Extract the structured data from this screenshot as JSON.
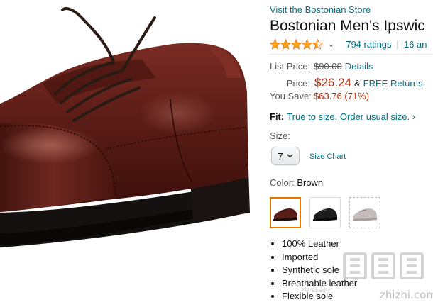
{
  "product": {
    "store_link": "Visit the Bostonian Store",
    "title": "Bostonian Men's Ipswic",
    "rating": {
      "stars": 4.5,
      "ratings_link": "794 ratings",
      "separator": "|",
      "answers_link": "16 an"
    }
  },
  "pricing": {
    "list_price_label": "List Price:",
    "list_price": "$90.00",
    "details_link": "Details",
    "price_label": "Price:",
    "price": "$26.24",
    "ampersand": "&",
    "returns_link": "FREE Returns",
    "save_label": "You Save:",
    "save_value": "$63.76 (71%)"
  },
  "fit": {
    "label": "Fit:",
    "link": "True to size. Order usual size. ›"
  },
  "size": {
    "label": "Size:",
    "selected": "7",
    "chart_link": "Size Chart"
  },
  "color": {
    "label": "Color:",
    "selected": "Brown",
    "swatches": [
      {
        "name": "brown",
        "selected": true
      },
      {
        "name": "black",
        "selected": false
      },
      {
        "name": "grey",
        "selected": false,
        "unavailable": true
      }
    ]
  },
  "features": [
    "100% Leather",
    "Imported",
    "Synthetic sole",
    "Breathable leather",
    "Flexible sole"
  ],
  "watermark": {
    "logo": "值",
    "url": "zhizhi.com",
    "small": "Malabadly"
  },
  "colors": {
    "link": "#007185",
    "price": "#b12704",
    "star": "#ffa41c",
    "shoe": "#5a1e18",
    "selected_border": "#e77600"
  }
}
